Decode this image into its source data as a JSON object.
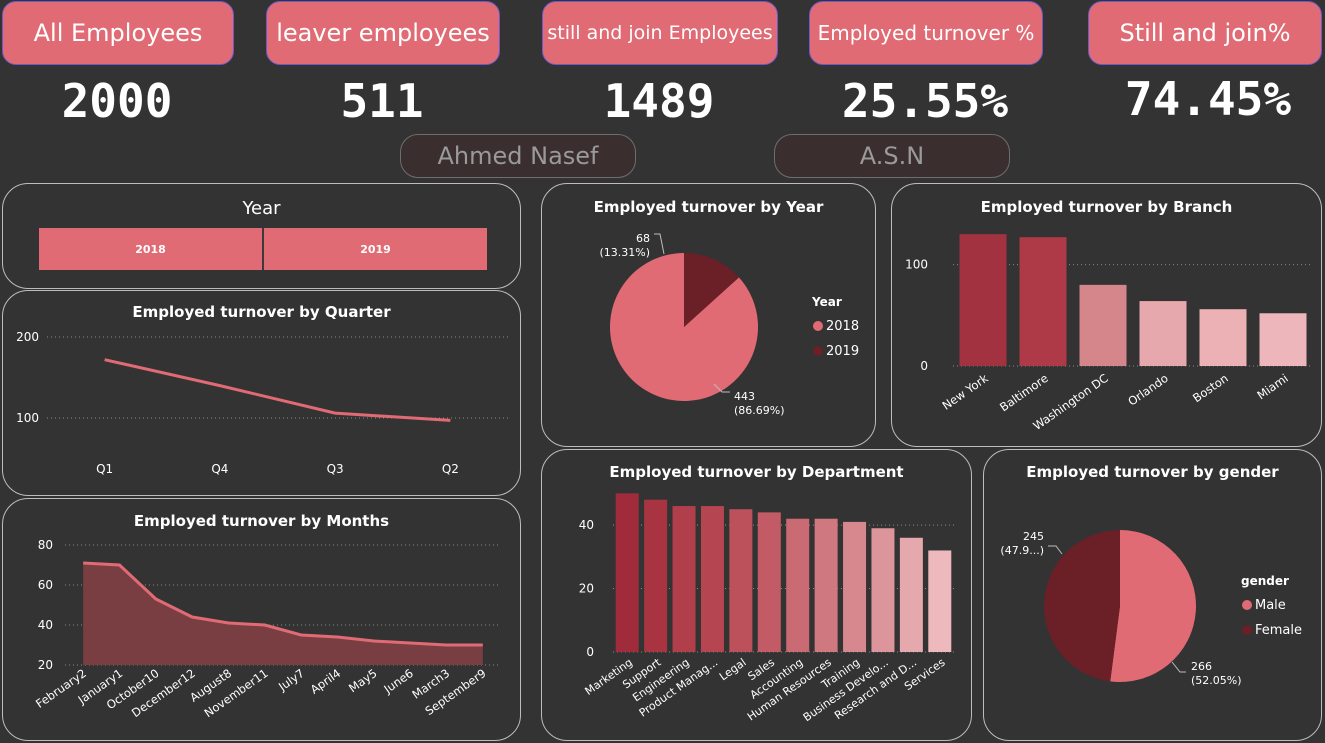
{
  "kpis": [
    {
      "label": "All Employees",
      "value": "2000"
    },
    {
      "label": "leaver employees",
      "value": "511"
    },
    {
      "label": "still and join Employees",
      "value": "1489"
    },
    {
      "label": "Employed turnover %",
      "value": "25.55%"
    },
    {
      "label": "Still and join%",
      "value": "74.45%"
    }
  ],
  "names": {
    "left": "Ahmed Nasef",
    "right": "A.S.N"
  },
  "year_slicer": {
    "title": "Year",
    "options": [
      "2018",
      "2019"
    ]
  },
  "colors": {
    "accent": "#e06b75",
    "dark": "#6b1f26",
    "bg": "#333333"
  },
  "chart_data": [
    {
      "id": "quarter",
      "type": "line",
      "title": "Employed turnover by Quarter",
      "categories": [
        "Q1",
        "Q4",
        "Q3",
        "Q2"
      ],
      "values": [
        172,
        140,
        106,
        97
      ],
      "yticks": [
        "200",
        "100"
      ],
      "ylim": [
        100,
        200
      ]
    },
    {
      "id": "months",
      "type": "area",
      "title": "Employed turnover by Months",
      "categories": [
        "February2",
        "January1",
        "October10",
        "December12",
        "August8",
        "November11",
        "July7",
        "April4",
        "May5",
        "June6",
        "March3",
        "September9"
      ],
      "values": [
        71,
        70,
        53,
        44,
        41,
        40,
        35,
        34,
        32,
        31,
        30,
        30
      ],
      "yticks": [
        "80",
        "60",
        "40",
        "20"
      ],
      "ylim": [
        20,
        80
      ]
    },
    {
      "id": "year",
      "type": "pie",
      "title": "Employed turnover by Year",
      "legend_title": "Year",
      "slices": [
        {
          "name": "2018",
          "value": 443,
          "label_value": "443",
          "label_pct": "(86.69%)"
        },
        {
          "name": "2019",
          "value": 68,
          "label_value": "68",
          "label_pct": "(13.31%)"
        }
      ]
    },
    {
      "id": "branch",
      "type": "bar",
      "title": "Employed turnover by Branch",
      "categories": [
        "New York",
        "Baltimore",
        "Washington DC",
        "Orlando",
        "Boston",
        "Miami"
      ],
      "values": [
        130,
        127,
        80,
        64,
        56,
        52
      ],
      "colors": [
        "#a23240",
        "#ae3a47",
        "#d5868b",
        "#e6a8ad",
        "#ebb1b5",
        "#ecb6ba"
      ],
      "yticks": [
        "100",
        "0"
      ],
      "ylim": [
        0,
        140
      ]
    },
    {
      "id": "department",
      "type": "bar",
      "title": "Employed turnover by Department",
      "categories": [
        "Marketing",
        "Support",
        "Engineering",
        "Product Manag...",
        "Legal",
        "Sales",
        "Accounting",
        "Human Resources",
        "Training",
        "Business Develo...",
        "Research and D...",
        "Services"
      ],
      "values": [
        50,
        48,
        46,
        46,
        45,
        44,
        42,
        42,
        41,
        39,
        36,
        32
      ],
      "colors": [
        "#a02c3b",
        "#a93441",
        "#b13f4b",
        "#b54550",
        "#bc505b",
        "#c35b66",
        "#ca6b74",
        "#cf7880",
        "#d7878e",
        "#dd959c",
        "#e5a8ad",
        "#edb9bd"
      ],
      "yticks": [
        "40",
        "20",
        "0"
      ],
      "ylim": [
        0,
        52
      ]
    },
    {
      "id": "gender",
      "type": "pie",
      "title": "Employed turnover by gender",
      "legend_title": "gender",
      "slices": [
        {
          "name": "Male",
          "value": 266,
          "label_value": "266",
          "label_pct": "(52.05%)"
        },
        {
          "name": "Female",
          "value": 245,
          "label_value": "245",
          "label_pct": "(47.9...)"
        }
      ]
    }
  ]
}
